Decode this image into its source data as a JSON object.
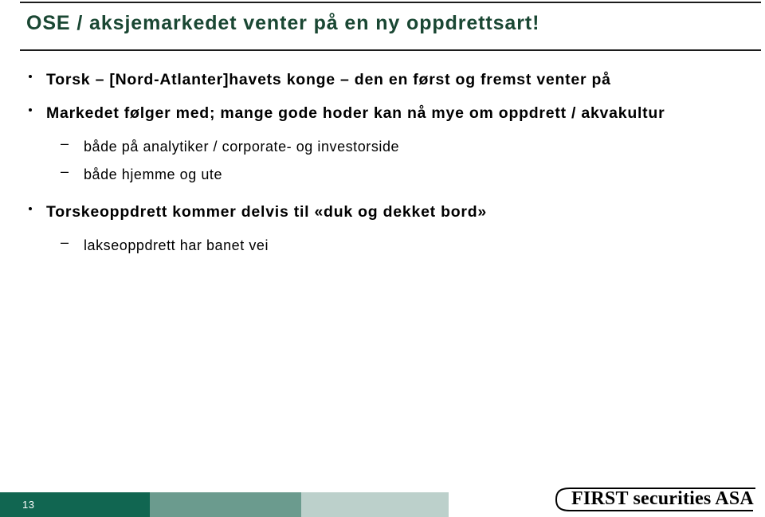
{
  "slide": {
    "title": "OSE / aksjemarkedet venter på en ny oppdrettsart!",
    "title_color": "#1a4733",
    "bullets": [
      {
        "level": 1,
        "marker": "bullet-dot",
        "text": "Torsk – [Nord-Atlanter]havets konge – den en først og fremst venter på"
      },
      {
        "level": 1,
        "marker": "bullet-dot",
        "text": "Markedet følger med; mange gode hoder kan nå mye om oppdrett / akvakultur"
      },
      {
        "level": 2,
        "marker": "en-dash",
        "text": "både på analytiker / corporate- og investorside"
      },
      {
        "level": 2,
        "marker": "en-dash",
        "text": "både hjemme og ute"
      },
      {
        "level": 1,
        "marker": "bullet-dot",
        "text": "Torskeoppdrett kommer delvis til «duk og dekket bord»"
      },
      {
        "level": 2,
        "marker": "en-dash",
        "text": "lakseoppdrett har banet vei"
      }
    ],
    "dash_marker": "–"
  },
  "footer": {
    "page_number": "13",
    "bands": [
      {
        "name": "dark-band",
        "color": "#116651"
      },
      {
        "name": "mid-band",
        "color": "#6b9b8e"
      },
      {
        "name": "light-band",
        "color": "#bcd0cb"
      }
    ],
    "logo_text": "FIRST securities ASA"
  }
}
